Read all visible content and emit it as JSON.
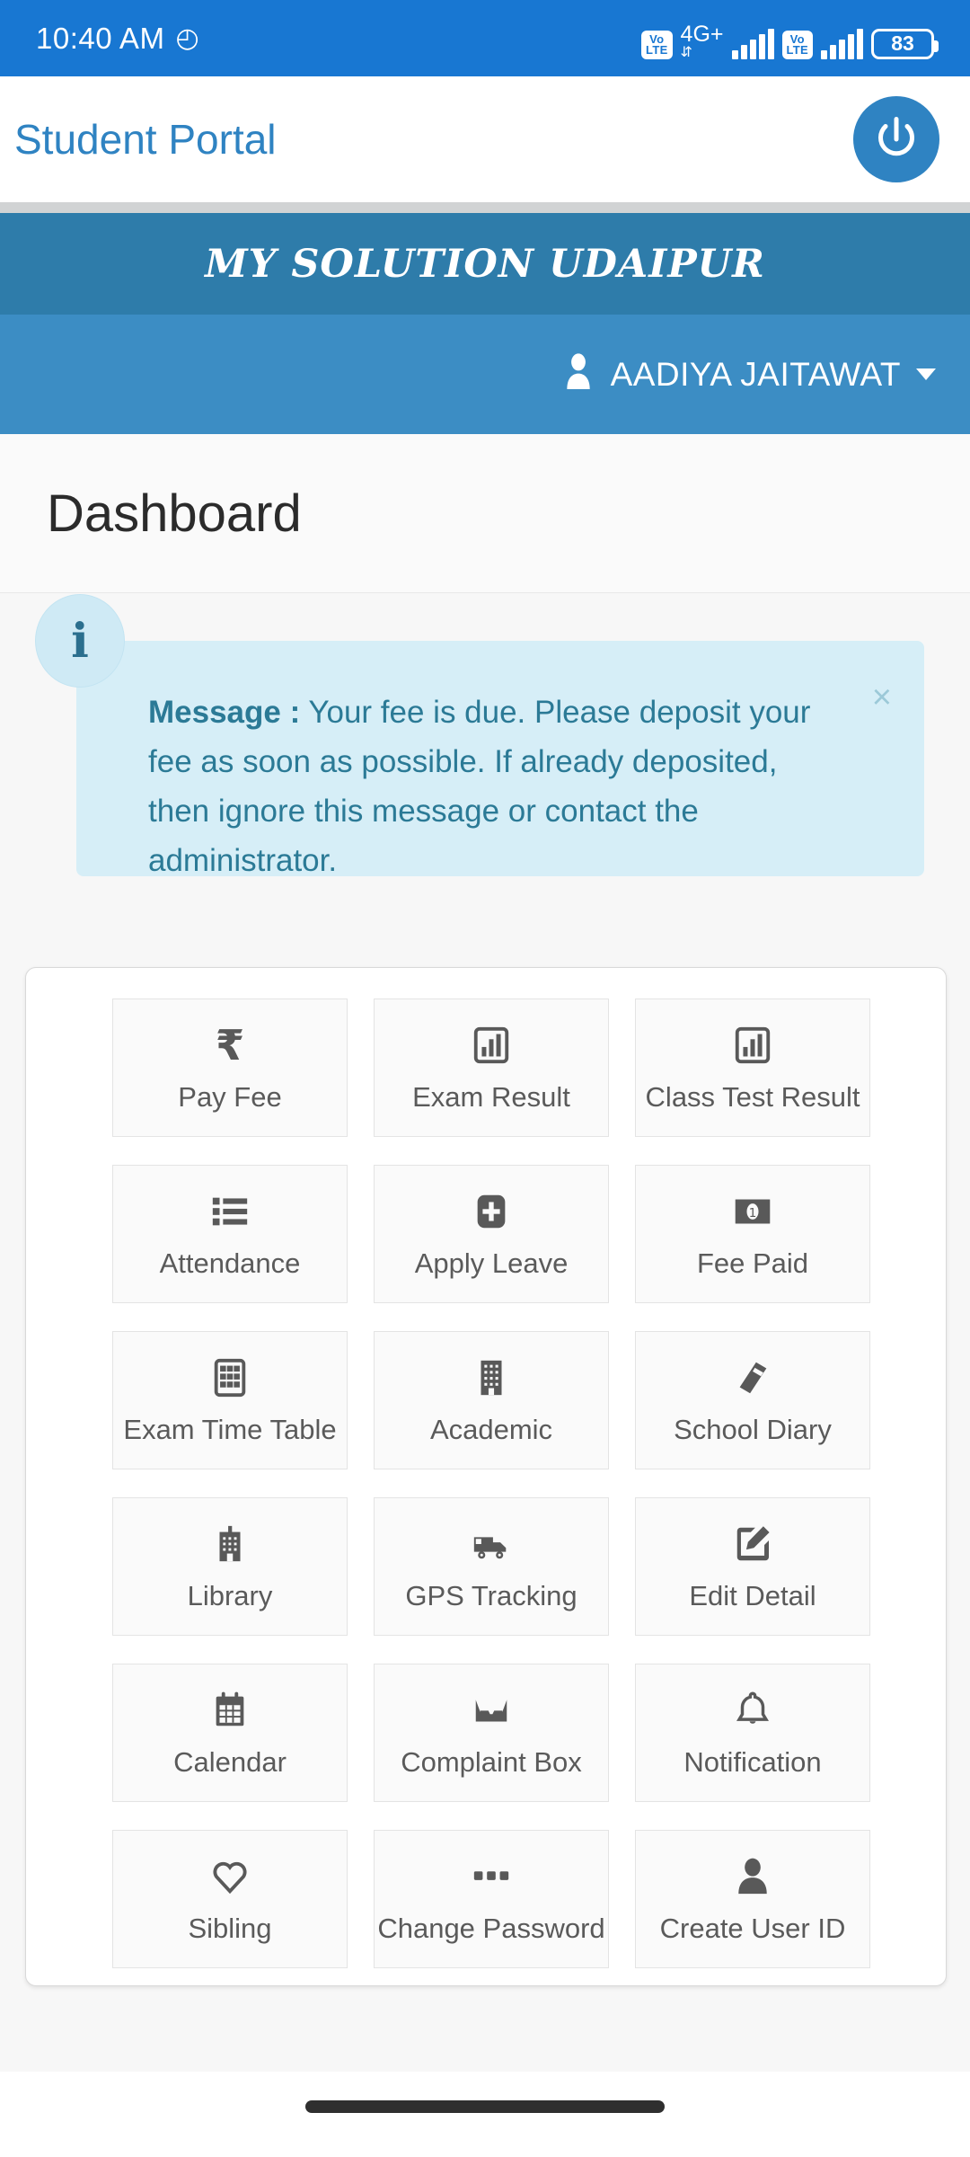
{
  "status_bar": {
    "time": "10:40 AM",
    "alarm_icon": "alarm-icon",
    "volte_line1": "Vo",
    "volte_line2": "LTE",
    "network_type": "4G+",
    "network_sub": "⇵",
    "battery_level": "83"
  },
  "app_bar": {
    "title": "Student Portal",
    "power_icon": "power-icon"
  },
  "banner": {
    "school_name": "MY SOLUTION UDAIPUR"
  },
  "user_bar": {
    "user_icon": "person-icon",
    "user_name": "AADIYA JAITAWAT",
    "caret_icon": "caret-down-icon"
  },
  "page": {
    "title": "Dashboard"
  },
  "alert": {
    "info_icon": "info-icon",
    "info_glyph": "i",
    "label": "Message :",
    "body": " Your fee is due. Please deposit your fee as soon as possible. If already deposited, then ignore this message or contact the administrator.",
    "close_label": "×"
  },
  "menu": {
    "tiles": [
      {
        "label": "Pay Fee",
        "icon": "rupee-icon"
      },
      {
        "label": "Exam Result",
        "icon": "bar-chart-icon"
      },
      {
        "label": "Class Test Result",
        "icon": "bar-chart-icon"
      },
      {
        "label": "Attendance",
        "icon": "list-icon"
      },
      {
        "label": "Apply Leave",
        "icon": "plus-square-icon"
      },
      {
        "label": "Fee Paid",
        "icon": "banknote-icon"
      },
      {
        "label": "Exam Time Table",
        "icon": "table-grid-icon"
      },
      {
        "label": "Academic",
        "icon": "building-icon"
      },
      {
        "label": "School Diary",
        "icon": "book-icon"
      },
      {
        "label": "Library",
        "icon": "hospital-building-icon"
      },
      {
        "label": "GPS Tracking",
        "icon": "truck-icon"
      },
      {
        "label": "Edit Detail",
        "icon": "pencil-square-icon"
      },
      {
        "label": "Calendar",
        "icon": "calendar-icon"
      },
      {
        "label": "Complaint Box",
        "icon": "inbox-icon"
      },
      {
        "label": "Notification",
        "icon": "bell-icon"
      },
      {
        "label": "Sibling",
        "icon": "heart-icon"
      },
      {
        "label": "Change Password",
        "icon": "ellipsis-icon"
      },
      {
        "label": "Create User ID",
        "icon": "person-icon"
      }
    ]
  },
  "colors": {
    "status_bar": "#1877d2",
    "banner": "#2e7caa",
    "user_bar": "#3c8dc4",
    "accent": "#2f83c2",
    "alert_bg": "#d6eef7",
    "alert_text": "#2b7a96"
  }
}
